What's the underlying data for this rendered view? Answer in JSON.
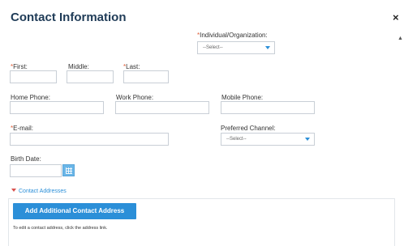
{
  "dialog": {
    "title": "Contact Information",
    "close_glyph": "×",
    "scroll_glyph": "▲"
  },
  "fields": {
    "required_marker": "*",
    "individual_org": {
      "label": "Individual/Organization:",
      "value": "--Select--"
    },
    "first": {
      "label": "First:",
      "value": ""
    },
    "middle": {
      "label": "Middle:",
      "value": ""
    },
    "last": {
      "label": "Last:",
      "value": ""
    },
    "home_phone": {
      "label": "Home Phone:",
      "value": ""
    },
    "work_phone": {
      "label": "Work Phone:",
      "value": ""
    },
    "mobile_phone": {
      "label": "Mobile Phone:",
      "value": ""
    },
    "email": {
      "label": "E-mail:",
      "value": ""
    },
    "preferred_channel": {
      "label": "Preferred Channel:",
      "value": "--Select--"
    },
    "birth_date": {
      "label": "Birth Date:",
      "value": ""
    }
  },
  "addresses": {
    "section_label": "Contact Addresses",
    "add_button": "Add Additional Contact Address",
    "hint": "To edit a contact address, click the address link."
  },
  "colors": {
    "title": "#1f3b57",
    "accent": "#2b8fd8",
    "required": "#e0603a",
    "border": "#c9cfd6"
  },
  "icons": [
    "close-icon",
    "chevron-up-icon",
    "chevron-down-icon",
    "calendar-icon",
    "caret-down-icon"
  ]
}
